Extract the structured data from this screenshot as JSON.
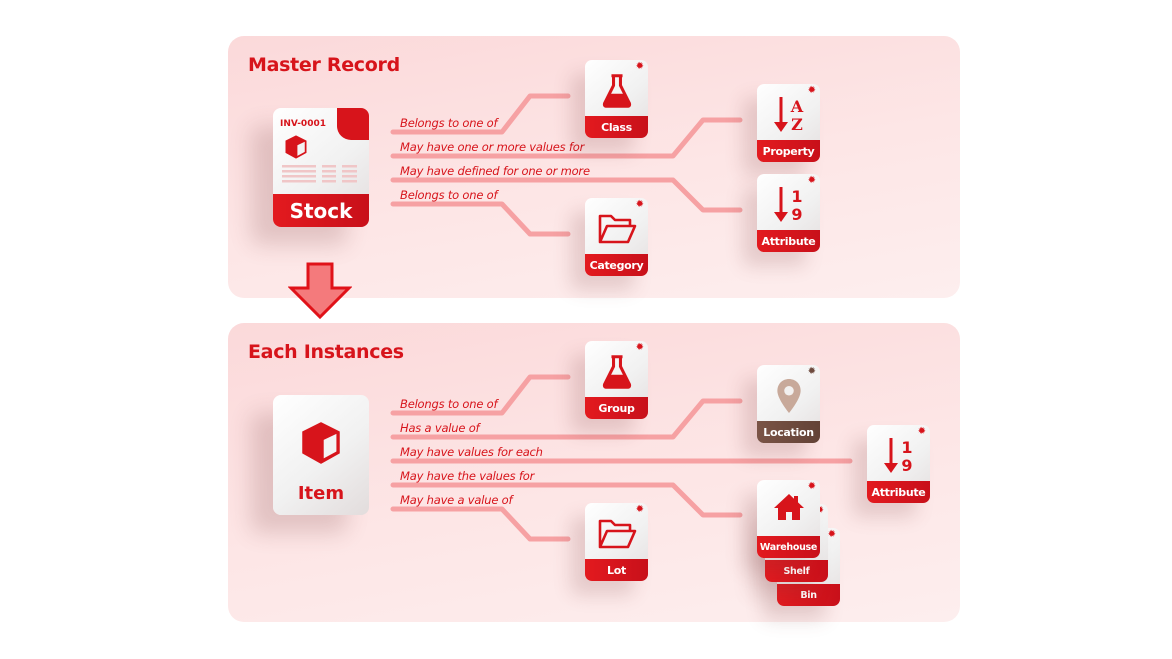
{
  "colors": {
    "accent": "#d7141b",
    "line": "#f6a1a3",
    "panel_bg": "#fde6e6",
    "location_brown": "#6e4a3e",
    "location_pin": "#c8a99a",
    "arrow_fill": "#f47a7c"
  },
  "master": {
    "title": "Master Record",
    "source": {
      "label": "Stock",
      "doc_id": "INV-0001",
      "icon": "cube-icon"
    },
    "relations": [
      {
        "label": "Belongs to one of",
        "target": "Class"
      },
      {
        "label": "May have one or more  values for",
        "target": "Property"
      },
      {
        "label": "May have defined for one or more",
        "target": "Attribute"
      },
      {
        "label": "Belongs to one of",
        "target": "Category"
      }
    ],
    "targets": [
      {
        "label": "Class",
        "icon": "flask-icon"
      },
      {
        "label": "Property",
        "icon": "sort-alpha-icon",
        "glyph_top": "A",
        "glyph_bottom": "Z"
      },
      {
        "label": "Attribute",
        "icon": "sort-numeric-icon",
        "glyph_top": "1",
        "glyph_bottom": "9"
      },
      {
        "label": "Category",
        "icon": "folder-open-icon"
      }
    ]
  },
  "transition": {
    "icon": "arrow-down-icon"
  },
  "instances": {
    "title": "Each Instances",
    "source": {
      "label": "Item",
      "icon": "cube-icon"
    },
    "relations": [
      {
        "label": "Belongs to one of",
        "target": "Group"
      },
      {
        "label": "Has a value of",
        "target": "Location"
      },
      {
        "label": "May have values for each",
        "target": "Attribute"
      },
      {
        "label": "May have the values for",
        "target": "Warehouse"
      },
      {
        "label": "May have a value of",
        "target": "Lot"
      }
    ],
    "targets": [
      {
        "label": "Group",
        "icon": "flask-icon"
      },
      {
        "label": "Location",
        "icon": "map-pin-icon"
      },
      {
        "label": "Attribute",
        "icon": "sort-numeric-icon",
        "glyph_top": "1",
        "glyph_bottom": "9"
      },
      {
        "label": "Warehouse",
        "icon": "home-icon"
      },
      {
        "label": "Shelf",
        "icon": ""
      },
      {
        "label": "Bin",
        "icon": ""
      },
      {
        "label": "Lot",
        "icon": "folder-open-icon"
      }
    ]
  },
  "gear_glyph": "✹"
}
